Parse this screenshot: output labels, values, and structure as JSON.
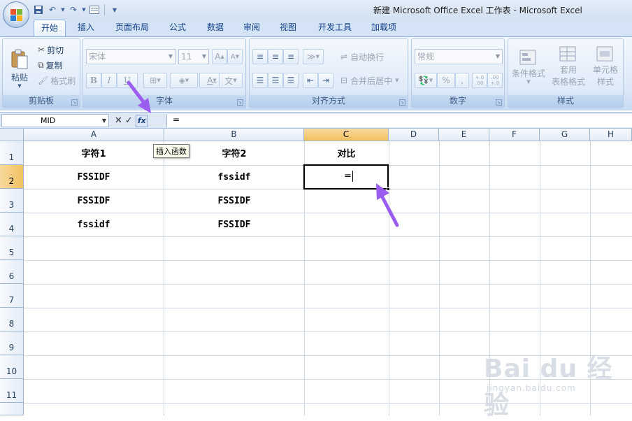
{
  "window": {
    "title": "新建 Microsoft Office Excel 工作表 - Microsoft Excel"
  },
  "tabs": [
    "开始",
    "插入",
    "页面布局",
    "公式",
    "数据",
    "审阅",
    "视图",
    "开发工具",
    "加载项"
  ],
  "ribbon": {
    "clipboard": {
      "label": "剪贴板",
      "paste": "粘贴",
      "cut": "剪切",
      "copy": "复制",
      "format_painter": "格式刷"
    },
    "font": {
      "label": "字体",
      "font_name": "宋体",
      "font_size": "11",
      "bold": "B",
      "italic": "I",
      "underline": "U",
      "grow": "A",
      "shrink": "A",
      "font_color": "A",
      "phonetic": "文"
    },
    "alignment": {
      "label": "对齐方式",
      "wrap": "自动换行",
      "merge": "合并后居中"
    },
    "number": {
      "label": "数字",
      "format": "常规",
      "percent": "%",
      "comma": ",",
      "inc_dec": "+.0 .00",
      "dec_dec": ".00 +.0"
    },
    "styles": {
      "label": "样式",
      "conditional": "条件格式",
      "table_format_1": "套用",
      "table_format_2": "表格格式",
      "cell_style_1": "单元格",
      "cell_style_2": "样式"
    }
  },
  "formula_bar": {
    "name_box": "MID",
    "cancel": "✕",
    "enter": "✓",
    "fx": "fx",
    "content": "="
  },
  "tooltip": "插入函数",
  "columns": [
    "A",
    "B",
    "C",
    "D",
    "E",
    "F",
    "G",
    "H"
  ],
  "rows": [
    "1",
    "2",
    "3",
    "4",
    "5",
    "6",
    "7",
    "8",
    "9",
    "10",
    "11"
  ],
  "cells": {
    "A1": "字符1",
    "B1": "字符2",
    "C1": "对比",
    "A2": "FSSIDF",
    "B2": "fssidf",
    "A3": "FSSIDF",
    "B3": "FSSIDF",
    "A4": "fssidf",
    "B4": "FSSIDF",
    "C2_editing": "="
  },
  "selection": {
    "column": "C",
    "row": "2"
  },
  "annotation_color": "#9b5cf0",
  "watermark": {
    "brand": "Bai du 经验",
    "url": "jingyan.baidu.com"
  }
}
